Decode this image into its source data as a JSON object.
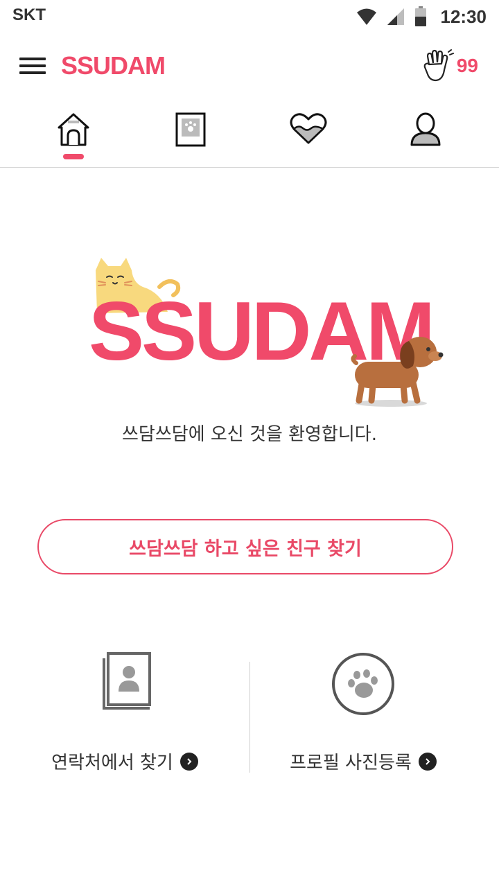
{
  "status_bar": {
    "carrier": "SKT",
    "time": "12:30",
    "icons": [
      "wifi-icon",
      "signal-icon",
      "battery-icon"
    ]
  },
  "app_bar": {
    "logo": "SSUDAM",
    "clap_count": "99",
    "icons": [
      "menu-icon",
      "clap-hand-icon"
    ]
  },
  "tabs": [
    {
      "name": "home",
      "icon": "doghouse-icon",
      "active": true
    },
    {
      "name": "photos",
      "icon": "photo-frame-icon",
      "active": false
    },
    {
      "name": "favorites",
      "icon": "heart-icon",
      "active": false
    },
    {
      "name": "profile",
      "icon": "person-icon",
      "active": false
    }
  ],
  "hero": {
    "logo_text": "SSUDAM",
    "welcome": "쓰담쓰담에 오신 것을 환영합니다."
  },
  "find_friends_button": "쓰담쓰담 하고 싶은 친구 찾기",
  "actions": [
    {
      "label": "연락처에서 찾기",
      "icon": "contact-book-icon"
    },
    {
      "label": "프로필 사진등록",
      "icon": "paw-icon"
    }
  ],
  "colors": {
    "accent": "#f04a6a",
    "text": "#333333",
    "cat": "#f8d97e",
    "dog": "#b86f3e"
  }
}
